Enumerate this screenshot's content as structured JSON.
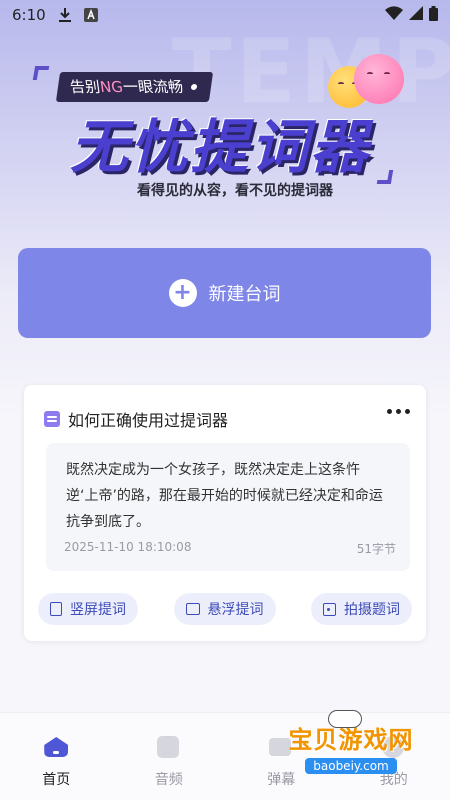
{
  "status_bar": {
    "time": "6:10"
  },
  "banner": {
    "tag_prefix": "告别",
    "tag_ng": "NG",
    "tag_suffix": " 一眼流畅",
    "title": "无忧提词器",
    "subtitle": "看得见的从容，看不见的提词器"
  },
  "new_button": {
    "label": "新建台词"
  },
  "card": {
    "title": "如何正确使用过提词器",
    "body": "既然决定成为一个女孩子，既然决定走上这条忤逆‘上帝’的路，那在最开始的时候就已经决定和命运抗争到底了。",
    "timestamp": "2025-11-10 18:10:08",
    "char_count": "51字节",
    "actions": [
      {
        "label": "竖屏提词",
        "icon": "phone-portrait-icon"
      },
      {
        "label": "悬浮提词",
        "icon": "float-window-icon"
      },
      {
        "label": "拍摄题词",
        "icon": "camera-icon"
      }
    ]
  },
  "bottom_nav": {
    "items": [
      {
        "label": "首页",
        "icon": "home-icon",
        "active": true
      },
      {
        "label": "音频",
        "icon": "music-icon",
        "active": false
      },
      {
        "label": "弹幕",
        "icon": "bullet-icon",
        "active": false
      },
      {
        "label": "我的",
        "icon": "user-icon",
        "active": false
      }
    ]
  },
  "watermark": {
    "main": "宝贝游戏网",
    "url": "baobeiy.com"
  },
  "colors": {
    "accent": "#7e86e8",
    "title_purple": "#4a3fcf",
    "tag_bg": "#2f2950",
    "pill_text": "#3d4ab8",
    "nav_active": "#4f57d6"
  }
}
